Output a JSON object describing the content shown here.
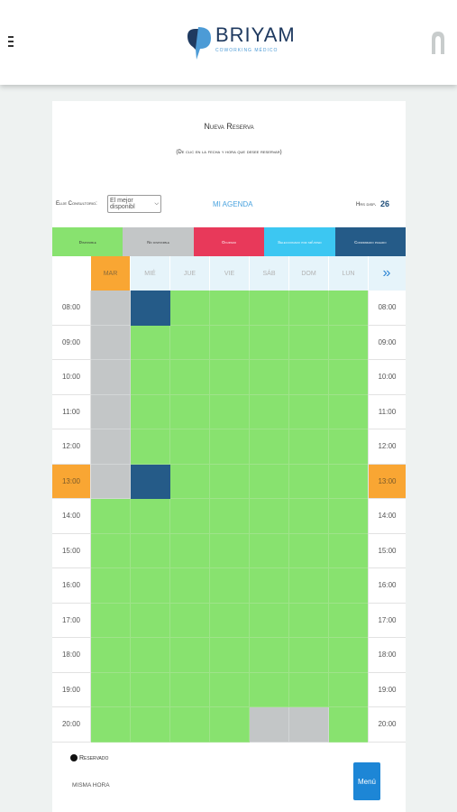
{
  "header": {
    "logo_title": "BRIYAM",
    "logo_subtitle": "COWORKING MÉDICO"
  },
  "form": {
    "title": "Nueva Reserva",
    "subtitle": "(De clic en la fecha y hora que desee reservar)",
    "consultorio_label": "Elije Consultorio:",
    "consultorio_value": "El mejor disponibl",
    "agenda_link": "MI AGENDA",
    "hrs_label": "Hrs disp.",
    "hrs_value": "26"
  },
  "legend": {
    "disponible": "Disponible",
    "no_disponible": "No disponible",
    "ocupado": "Ocupado",
    "seleccionado": "Seleccionado por mi/usted",
    "confirmado": "Confirmado pagado"
  },
  "days": [
    "MAR",
    "MIÉ",
    "JUE",
    "VIE",
    "SÁB",
    "DOM",
    "LUN"
  ],
  "active_day_index": 0,
  "next_label": "»",
  "hours": [
    "08:00",
    "09:00",
    "10:00",
    "11:00",
    "12:00",
    "13:00",
    "14:00",
    "15:00",
    "16:00",
    "17:00",
    "18:00",
    "19:00",
    "20:00"
  ],
  "highlighted_hour_index": 5,
  "slots": [
    [
      "n",
      "c",
      "d",
      "d",
      "d",
      "d",
      "d"
    ],
    [
      "n",
      "d",
      "d",
      "d",
      "d",
      "d",
      "d"
    ],
    [
      "n",
      "d",
      "d",
      "d",
      "d",
      "d",
      "d"
    ],
    [
      "n",
      "d",
      "d",
      "d",
      "d",
      "d",
      "d"
    ],
    [
      "n",
      "d",
      "d",
      "d",
      "d",
      "d",
      "d"
    ],
    [
      "n",
      "c",
      "d",
      "d",
      "d",
      "d",
      "d"
    ],
    [
      "d",
      "d",
      "d",
      "d",
      "d",
      "d",
      "d"
    ],
    [
      "d",
      "d",
      "d",
      "d",
      "d",
      "d",
      "d"
    ],
    [
      "d",
      "d",
      "d",
      "d",
      "d",
      "d",
      "d"
    ],
    [
      "d",
      "d",
      "d",
      "d",
      "d",
      "d",
      "d"
    ],
    [
      "d",
      "d",
      "d",
      "d",
      "d",
      "d",
      "d"
    ],
    [
      "d",
      "d",
      "d",
      "d",
      "d",
      "d",
      "d"
    ],
    [
      "d",
      "d",
      "d",
      "d",
      "n",
      "n",
      "d"
    ]
  ],
  "footer": {
    "reserved_label": "Reservado",
    "misma_hora": "MISMA HORA",
    "menu_label": "Menú"
  },
  "colors": {
    "disponible": "#88e26f",
    "no_disponible": "#c3c6c7",
    "ocupado": "#e8395a",
    "seleccionado": "#3cc7f2",
    "confirmado": "#255b88",
    "highlight": "#f9a633"
  }
}
